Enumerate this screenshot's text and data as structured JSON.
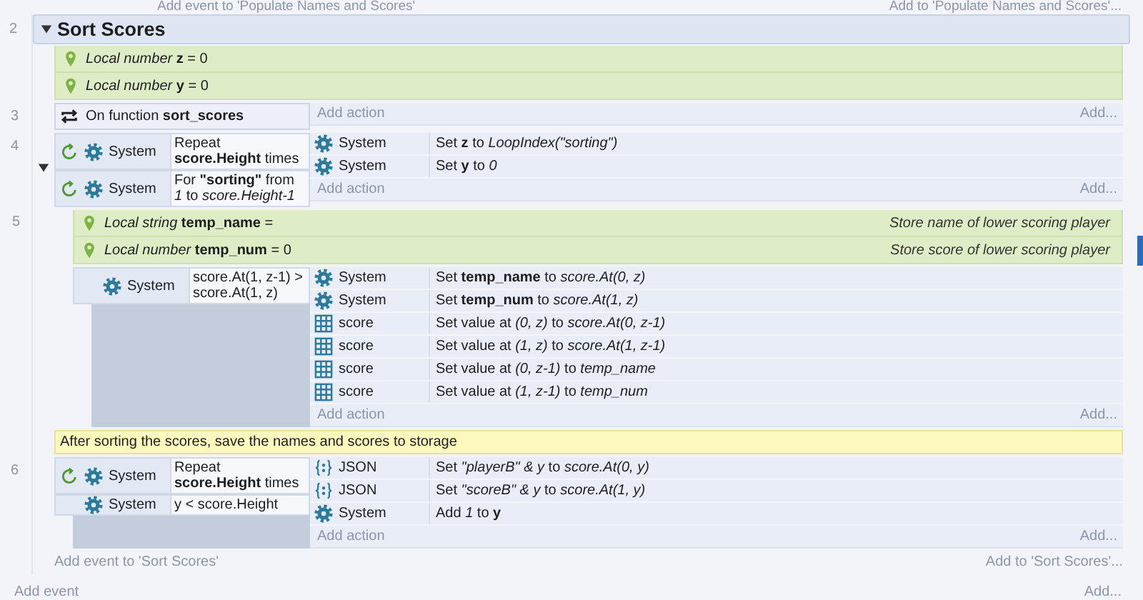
{
  "top_cut": {
    "left": "Add event to 'Populate Names and Scores'",
    "right": "Add to 'Populate Names and Scores'..."
  },
  "group": {
    "line_number": "2",
    "title": "Sort Scores",
    "expanded": true,
    "rows": [
      {
        "kind": "variable",
        "text": "*Local number* **z** = 0"
      },
      {
        "kind": "variable",
        "text": "*Local number* **y** = 0"
      },
      {
        "kind": "event",
        "line_number": "3",
        "conditions": [
          {
            "kind": "trigger",
            "text": "On function **sort_scores**"
          }
        ],
        "actions": [],
        "add_action": "Add action",
        "add_more": "Add..."
      },
      {
        "kind": "event",
        "line_number": "4",
        "expanded": true,
        "conditions": [
          {
            "kind": "system",
            "loop": true,
            "object": "System",
            "text": "Repeat **score.Height** times"
          },
          {
            "kind": "system",
            "loop": true,
            "object": "System",
            "text": "For **\"sorting\"** from *1* to *score.Height-1*"
          }
        ],
        "actions": [
          {
            "kind": "system",
            "object": "System",
            "text": "Set **z** to *LoopIndex(\"sorting\")*"
          },
          {
            "kind": "system",
            "object": "System",
            "text": "Set **y** to *0*"
          }
        ],
        "add_action": "Add action",
        "add_more": "Add...",
        "children": [
          {
            "kind": "variable",
            "line_number": "5",
            "text": "*Local string* **temp_name** =",
            "comment": "Store name of lower scoring player"
          },
          {
            "kind": "variable",
            "text": "*Local number* **temp_num** = 0",
            "comment": "Store score of lower scoring player"
          },
          {
            "kind": "event",
            "conditions": [
              {
                "kind": "system",
                "loop": false,
                "object": "System",
                "text": "score.At(1, z-1) > score.At(1, z)"
              }
            ],
            "actions": [
              {
                "kind": "system",
                "object": "System",
                "text": "Set **temp_name** to *score.At(0, z)*"
              },
              {
                "kind": "system",
                "object": "System",
                "text": "Set **temp_num** to *score.At(1, z)*"
              },
              {
                "kind": "array",
                "object": "score",
                "text": "Set value at *(0, z)* to *score.At(0, z-1)*"
              },
              {
                "kind": "array",
                "object": "score",
                "text": "Set value at *(1, z)* to *score.At(1, z-1)*"
              },
              {
                "kind": "array",
                "object": "score",
                "text": "Set value at *(0, z-1)* to *temp_name*"
              },
              {
                "kind": "array",
                "object": "score",
                "text": "Set value at *(1, z-1)* to *temp_num*"
              }
            ],
            "add_action": "Add action",
            "add_more": "Add..."
          }
        ]
      },
      {
        "kind": "comment",
        "text": "After sorting the scores, save the names and scores to storage"
      },
      {
        "kind": "event",
        "line_number": "6",
        "conditions": [
          {
            "kind": "system",
            "loop": true,
            "object": "System",
            "text": "Repeat **score.Height** times"
          },
          {
            "kind": "system",
            "loop": false,
            "object": "System",
            "text": "y < score.Height"
          }
        ],
        "actions": [
          {
            "kind": "json",
            "object": "JSON",
            "text": "Set *\"playerB\" & y* to *score.At(0, y)*"
          },
          {
            "kind": "json",
            "object": "JSON",
            "text": "Set *\"scoreB\" & y* to *score.At(1, y)*"
          },
          {
            "kind": "system",
            "object": "System",
            "text": "Add *1* to **y**"
          }
        ],
        "add_action": "Add action",
        "add_more": "Add..."
      }
    ],
    "add_event": "Add event to 'Sort Scores'",
    "add_more": "Add to 'Sort Scores'..."
  },
  "footer": {
    "add_event": "Add event",
    "add_more": "Add..."
  }
}
